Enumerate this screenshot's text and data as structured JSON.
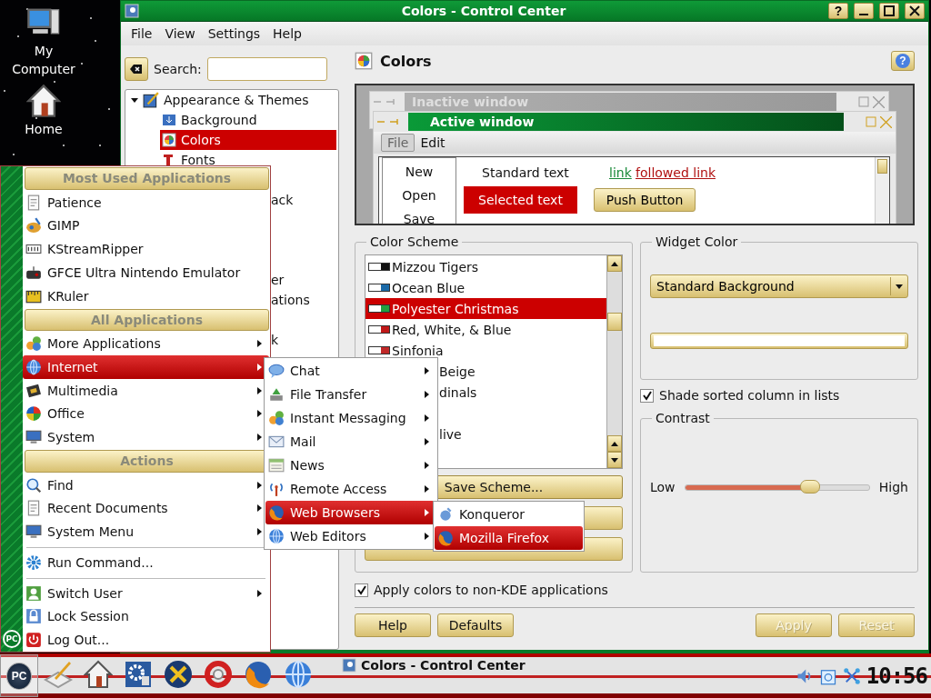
{
  "desktop": {
    "icons": [
      {
        "label": "My Computer"
      },
      {
        "label": "Home"
      }
    ]
  },
  "window": {
    "title": "Colors - Control Center",
    "title_buttons": [
      "?"
    ],
    "menu": [
      "File",
      "View",
      "Settings",
      "Help"
    ],
    "search": {
      "label": "Search:"
    },
    "tree": [
      {
        "label": "Appearance & Themes",
        "expanded": true,
        "children": [
          {
            "label": "Background",
            "selected": false
          },
          {
            "label": "Colors",
            "selected": true
          },
          {
            "label": "Fonts",
            "selected": false
          },
          {
            "kind": "covered"
          },
          {
            "kind": "clipped",
            "label": "ack"
          },
          {
            "kind": "covered"
          },
          {
            "kind": "covered"
          },
          {
            "kind": "covered"
          },
          {
            "kind": "clipped",
            "label": "er"
          },
          {
            "kind": "clipped",
            "label": "ations"
          },
          {
            "kind": "covered"
          },
          {
            "kind": "clipped",
            "label": "k"
          }
        ]
      }
    ],
    "module": {
      "title": "Colors",
      "help": "?"
    },
    "preview": {
      "inactive_title": "Inactive window",
      "active_title": "Active window",
      "menu": [
        "File",
        "Edit"
      ],
      "popup": [
        "New",
        "Open",
        "Save"
      ],
      "standard_text": "Standard text",
      "selected_text": "Selected text",
      "link": "link",
      "followed_link": "followed link",
      "push_button": "Push Button"
    },
    "color_scheme": {
      "title": "Color Scheme",
      "schemes": [
        {
          "label": "Mizzou Tigers",
          "color": "#111111",
          "selected": false
        },
        {
          "label": "Ocean Blue",
          "color": "#1a6aa8",
          "selected": false
        },
        {
          "label": "Polyester Christmas",
          "color": "#22a040",
          "selected": true
        },
        {
          "label": "Red, White, & Blue",
          "color": "#c01818",
          "selected": false
        },
        {
          "label": "Sinfonia",
          "color": "#c02828",
          "selected": false
        },
        {
          "kind": "clipped",
          "label": "Beige"
        },
        {
          "kind": "clipped",
          "label": "dinals"
        },
        {
          "kind": "covered"
        },
        {
          "kind": "clipped",
          "label": "live"
        }
      ],
      "buttons": [
        {
          "label": "Save Scheme..."
        },
        {
          "kind": "covered"
        },
        {
          "kind": "covered"
        }
      ]
    },
    "widget_color": {
      "title": "Widget Color",
      "dropdown": "Standard Background"
    },
    "shade_sorted": {
      "label": "Shade sorted column in lists",
      "checked": true
    },
    "contrast": {
      "title": "Contrast",
      "low": "Low",
      "high": "High",
      "level": 0.68
    },
    "apply_non_kde": {
      "label": "Apply colors to non-KDE applications",
      "checked": true
    },
    "buttons": [
      {
        "label": "Help",
        "disabled": false
      },
      {
        "label": "Defaults",
        "disabled": false
      },
      {
        "label": "Apply",
        "disabled": true
      },
      {
        "label": "Reset",
        "disabled": true
      }
    ]
  },
  "kmenu": {
    "logo": "PC",
    "items": [
      {
        "kind": "header",
        "label": "Most Used Applications"
      },
      {
        "label": "Patience",
        "selected": false,
        "submenu": false
      },
      {
        "label": "GIMP",
        "selected": false,
        "submenu": false
      },
      {
        "label": "KStreamRipper",
        "selected": false,
        "submenu": false
      },
      {
        "label": "GFCE Ultra Nintendo Emulator",
        "selected": false,
        "submenu": false
      },
      {
        "label": "KRuler",
        "selected": false,
        "submenu": false
      },
      {
        "kind": "header",
        "label": "All Applications"
      },
      {
        "label": "More Applications",
        "selected": false,
        "submenu": true
      },
      {
        "label": "Internet",
        "selected": true,
        "submenu": true
      },
      {
        "label": "Multimedia",
        "selected": false,
        "submenu": true
      },
      {
        "label": "Office",
        "selected": false,
        "submenu": true
      },
      {
        "label": "System",
        "selected": false,
        "submenu": true
      },
      {
        "kind": "header",
        "label": "Actions"
      },
      {
        "label": "Find",
        "selected": false,
        "submenu": true
      },
      {
        "label": "Recent Documents",
        "selected": false,
        "submenu": true
      },
      {
        "label": "System Menu",
        "selected": false,
        "submenu": true
      },
      {
        "kind": "separator"
      },
      {
        "label": "Run Command...",
        "selected": false,
        "submenu": false
      },
      {
        "kind": "separator"
      },
      {
        "label": "Switch User",
        "selected": false,
        "submenu": true
      },
      {
        "label": "Lock Session",
        "selected": false,
        "submenu": false
      },
      {
        "label": "Log Out...",
        "selected": false,
        "submenu": false
      }
    ]
  },
  "internet_menu": {
    "items": [
      {
        "label": "Chat",
        "selected": false,
        "submenu": true
      },
      {
        "label": "File Transfer",
        "selected": false,
        "submenu": true
      },
      {
        "label": "Instant Messaging",
        "selected": false,
        "submenu": true
      },
      {
        "label": "Mail",
        "selected": false,
        "submenu": true
      },
      {
        "label": "News",
        "selected": false,
        "submenu": true
      },
      {
        "label": "Remote Access",
        "selected": false,
        "submenu": true
      },
      {
        "label": "Web Browsers",
        "selected": true,
        "submenu": true
      },
      {
        "label": "Web Editors",
        "selected": false,
        "submenu": true
      }
    ]
  },
  "browsers_menu": {
    "items": [
      {
        "label": "Konqueror",
        "selected": false,
        "submenu": false
      },
      {
        "label": "Mozilla Firefox",
        "selected": true,
        "submenu": false
      }
    ]
  },
  "taskbar": {
    "logo": "PC",
    "task": "Colors - Control Center",
    "clock": "10:56"
  }
}
